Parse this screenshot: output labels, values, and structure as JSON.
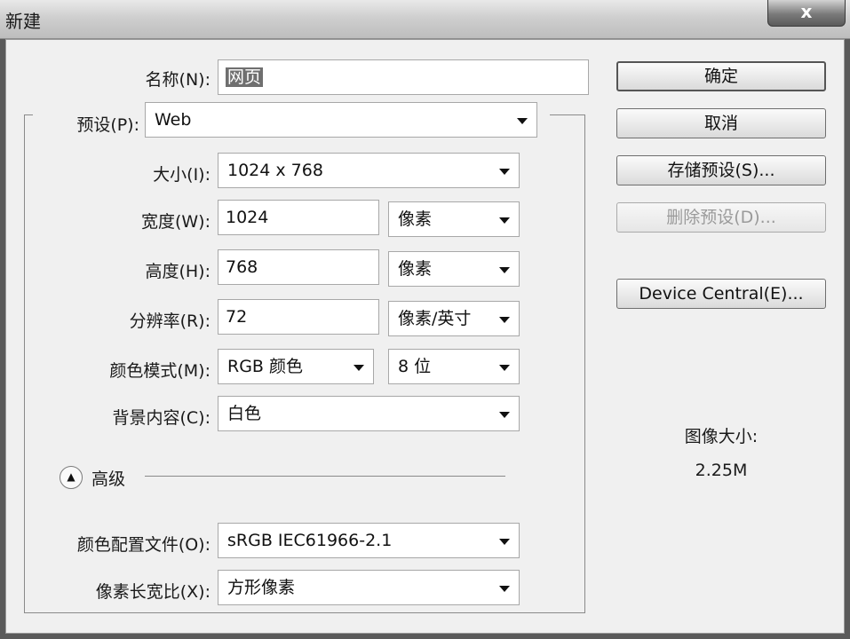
{
  "window": {
    "title": "新建",
    "close_label": "x"
  },
  "form": {
    "name": {
      "label": "名称(N):",
      "value": "网页"
    },
    "preset": {
      "label": "预设(P):",
      "value": "Web"
    },
    "size": {
      "label": "大小(I):",
      "value": "1024 x 768"
    },
    "width": {
      "label": "宽度(W):",
      "value": "1024",
      "unit": "像素"
    },
    "height": {
      "label": "高度(H):",
      "value": "768",
      "unit": "像素"
    },
    "resolution": {
      "label": "分辨率(R):",
      "value": "72",
      "unit": "像素/英寸"
    },
    "color_mode": {
      "label": "颜色模式(M):",
      "value": "RGB 颜色",
      "depth": "8 位"
    },
    "background": {
      "label": "背景内容(C):",
      "value": "白色"
    },
    "advanced": {
      "label": "高级"
    },
    "color_profile": {
      "label": "颜色配置文件(O):",
      "value": "sRGB IEC61966-2.1"
    },
    "pixel_aspect": {
      "label": "像素长宽比(X):",
      "value": "方形像素"
    }
  },
  "buttons": {
    "ok": "确定",
    "cancel": "取消",
    "save_preset": "存储预设(S)...",
    "delete_preset": "删除预设(D)...",
    "device_central": "Device Central(E)..."
  },
  "image_size": {
    "label": "图像大小:",
    "value": "2.25M"
  }
}
